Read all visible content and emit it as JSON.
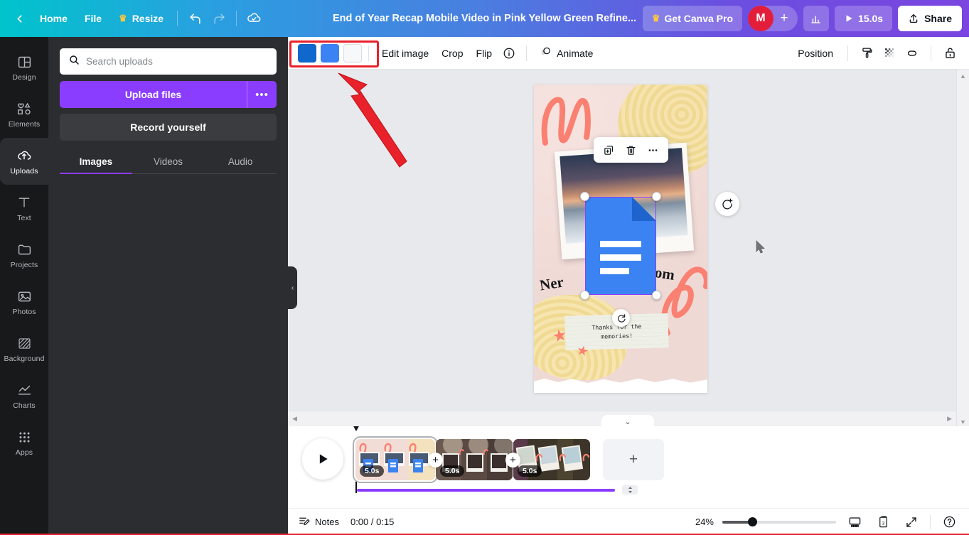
{
  "topbar": {
    "back_label": "",
    "home_label": "Home",
    "file_label": "File",
    "resize_label": "Resize",
    "undo_name": "undo-icon",
    "redo_name": "redo-icon",
    "cloud_name": "cloud-saved-icon",
    "title": "End of Year Recap Mobile Video in Pink Yellow Green Refine...",
    "get_pro_label": "Get Canva Pro",
    "avatar_initial": "M",
    "add_people_label": "+",
    "insights_name": "insights-icon",
    "duration_label": "15.0s",
    "share_label": "Share"
  },
  "rail": {
    "items": [
      {
        "label": "Design",
        "icon": "design-icon",
        "active": false
      },
      {
        "label": "Elements",
        "icon": "elements-icon",
        "active": false
      },
      {
        "label": "Uploads",
        "icon": "uploads-icon",
        "active": true
      },
      {
        "label": "Text",
        "icon": "text-icon",
        "active": false
      },
      {
        "label": "Projects",
        "icon": "projects-icon",
        "active": false
      },
      {
        "label": "Photos",
        "icon": "photos-icon",
        "active": false
      },
      {
        "label": "Background",
        "icon": "background-icon",
        "active": false
      },
      {
        "label": "Charts",
        "icon": "charts-icon",
        "active": false
      },
      {
        "label": "Apps",
        "icon": "apps-icon",
        "active": false
      }
    ]
  },
  "panel": {
    "search_placeholder": "Search uploads",
    "search_value": "",
    "upload_files_label": "Upload files",
    "upload_more_label": "•••",
    "record_label": "Record yourself",
    "tabs": [
      {
        "label": "Images",
        "active": true
      },
      {
        "label": "Videos",
        "active": false
      },
      {
        "label": "Audio",
        "active": false
      }
    ]
  },
  "toolbar": {
    "swatches": [
      {
        "name": "color-swatch-dark-blue",
        "color": "#1068cc"
      },
      {
        "name": "color-swatch-blue",
        "color": "#3b82f2"
      },
      {
        "name": "color-swatch-white",
        "color": "#f7f8f9"
      }
    ],
    "edit_image_label": "Edit image",
    "crop_label": "Crop",
    "flip_label": "Flip",
    "info_name": "info-icon",
    "animate_label": "Animate",
    "position_label": "Position",
    "paint_name": "paint-roller-icon",
    "transparency_name": "transparency-icon",
    "link_name": "link-icon",
    "lock_name": "lock-icon"
  },
  "canvas": {
    "note_text": "Thanks for the\nmemories!",
    "collage_word": "Ner om",
    "context_menu": {
      "duplicate_name": "duplicate-icon",
      "delete_name": "trash-icon",
      "more_name": "more-options-icon"
    },
    "rotate_name": "rotate-icon",
    "comment_name": "add-comment-icon"
  },
  "timeline": {
    "play_name": "play-icon",
    "scenes": [
      {
        "duration": "5.0s",
        "selected": true
      },
      {
        "duration": "5.0s",
        "selected": false
      },
      {
        "duration": "5.0s",
        "selected": false
      }
    ],
    "add_scene_label": "+",
    "insert_label": "+"
  },
  "statusbar": {
    "notes_label": "Notes",
    "time_label": "0:00 / 0:15",
    "zoom_label": "24%",
    "presenter_name": "presenter-view-icon",
    "pages_name": "pages-icon",
    "pages_count": "3",
    "fullscreen_name": "fullscreen-icon",
    "help_name": "help-icon"
  },
  "annotation": {
    "box_color": "#e8212a",
    "arrow_color": "#e8212a"
  }
}
